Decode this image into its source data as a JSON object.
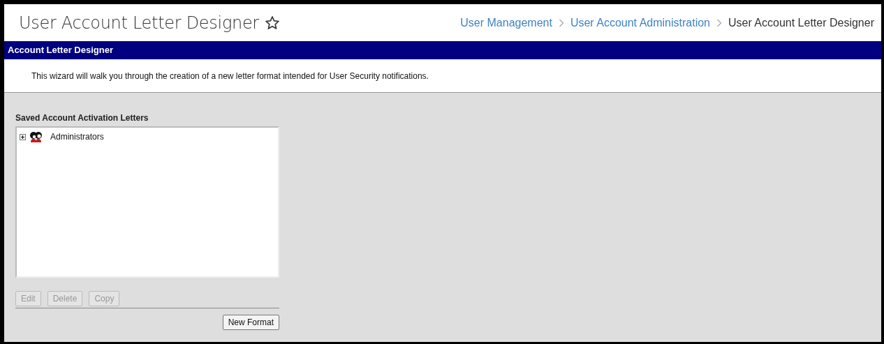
{
  "page": {
    "title": "User Account Letter Designer",
    "favorite": false
  },
  "breadcrumbs": [
    {
      "label": "User Management",
      "link": true
    },
    {
      "label": "User Account Administration",
      "link": true
    },
    {
      "label": "User Account Letter Designer",
      "link": false
    }
  ],
  "panel": {
    "title": "Account Letter Designer",
    "description": "This wizard will walk you through the creation of a new letter format intended for User Security notifications."
  },
  "tree": {
    "title": "Saved Account Activation Letters",
    "items": [
      {
        "label": "Administrators",
        "expanded": false,
        "selected": false
      }
    ]
  },
  "actions": [
    {
      "label": "Edit",
      "disabled": true
    },
    {
      "label": "Delete",
      "disabled": true
    },
    {
      "label": "Copy",
      "disabled": true
    }
  ],
  "new_button": {
    "label": "New Format",
    "disabled": false
  }
}
